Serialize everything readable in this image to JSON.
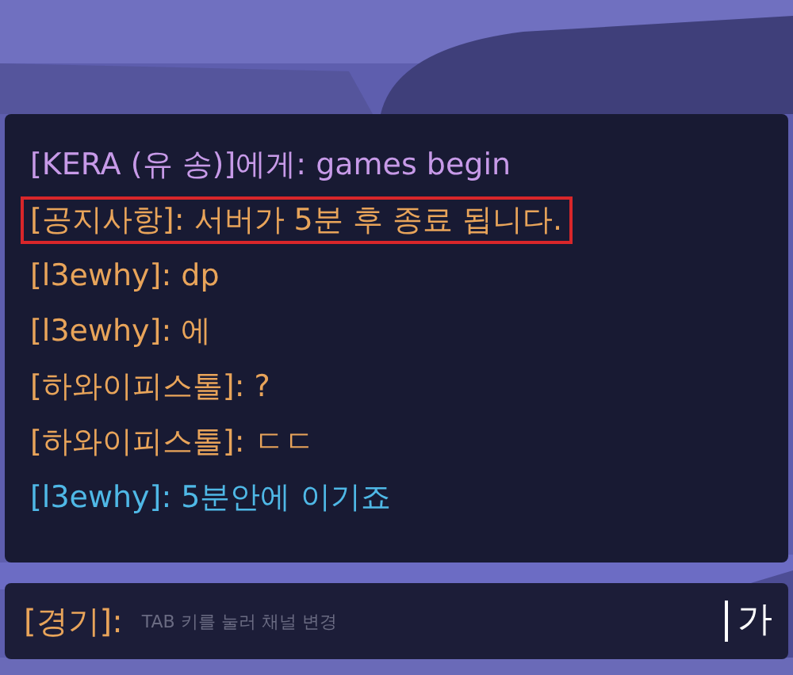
{
  "chat": {
    "messages": [
      {
        "kind": "whisper",
        "text": "[KERA (유 송)]에게: games begin",
        "highlighted": false
      },
      {
        "kind": "notice",
        "text": "[공지사항]: 서버가 5분 후 종료 됩니다.",
        "highlighted": true
      },
      {
        "kind": "normal",
        "text": "[l3ewhy]: dp",
        "highlighted": false
      },
      {
        "kind": "normal",
        "text": "[l3ewhy]: 에",
        "highlighted": false
      },
      {
        "kind": "normal",
        "text": "[하와이피스톨]: ?",
        "highlighted": false
      },
      {
        "kind": "normal",
        "text": "[하와이피스톨]: ㄷㄷ",
        "highlighted": false
      },
      {
        "kind": "team",
        "text": "[l3ewhy]: 5분안에 이기죠",
        "highlighted": false
      }
    ]
  },
  "input": {
    "channel": "[경기]:",
    "placeholder": "TAB 키를 눌러 채널 변경",
    "ime": "가"
  }
}
